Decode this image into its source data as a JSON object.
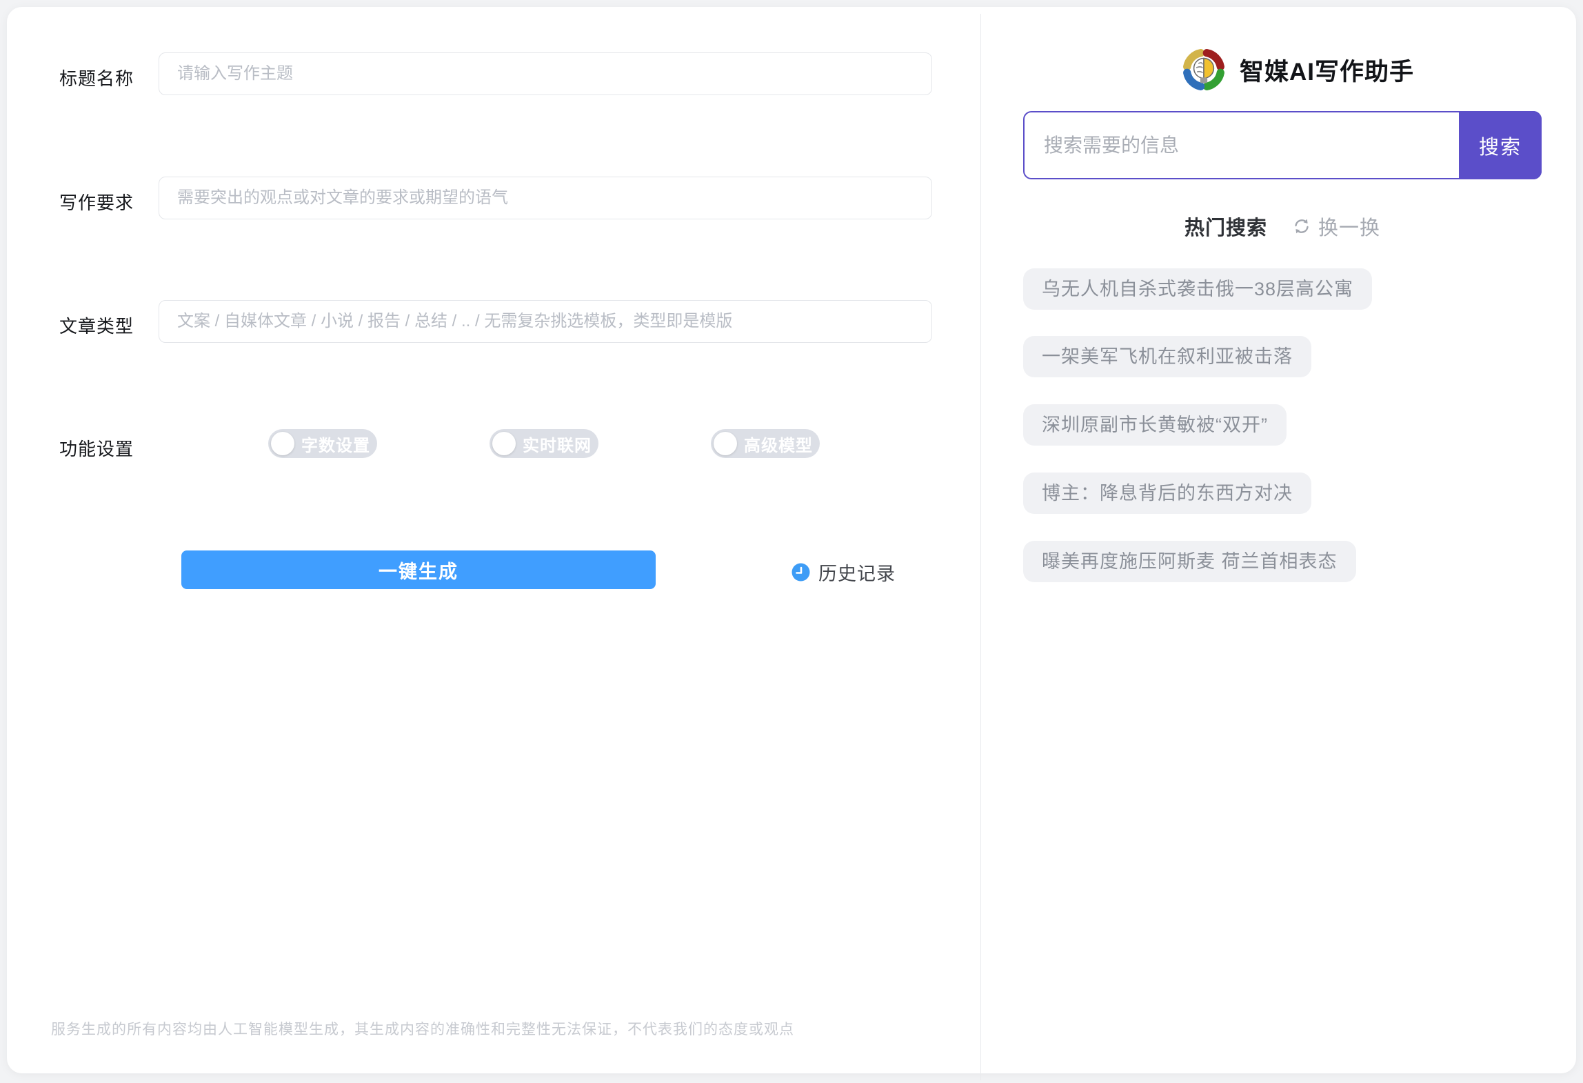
{
  "form": {
    "fields": [
      {
        "label": "标题名称",
        "placeholder": "请输入写作主题",
        "value": ""
      },
      {
        "label": "写作要求",
        "placeholder": "需要突出的观点或对文章的要求或期望的语气",
        "value": ""
      },
      {
        "label": "文章类型",
        "placeholder": "文案 / 自媒体文章 / 小说 / 报告 / 总结 / .. / 无需复杂挑选模板，类型即是模版",
        "value": ""
      }
    ],
    "settings": {
      "label": "功能设置",
      "toggles": [
        {
          "label": "字数设置",
          "state": "off"
        },
        {
          "label": "实时联网",
          "state": "off"
        },
        {
          "label": "高级模型",
          "state": "off"
        }
      ]
    },
    "generate_label": "一键生成",
    "history_label": "历史记录",
    "disclaimer": "服务生成的所有内容均由人工智能模型生成，其生成内容的准确性和完整性无法保证，不代表我们的态度或观点"
  },
  "panel": {
    "title": "智媒AI写作助手",
    "search": {
      "placeholder": "搜索需要的信息",
      "value": "",
      "button_label": "搜索"
    },
    "hot": {
      "title": "热门搜索",
      "refresh_label": "换一换",
      "items": [
        "乌无人机自杀式袭击俄一38层高公寓",
        "一架美军飞机在叙利亚被击落",
        "深圳原副市长黄敏被“双开”",
        "博主：降息背后的东西方对决",
        "曝美再度施压阿斯麦 荷兰首相表态"
      ]
    }
  },
  "colors": {
    "primary_blue": "#409eff",
    "accent_purple": "#5b4ec9",
    "clock_blue": "#3d9cf6",
    "toggle_gray": "#dcdfe6",
    "pill_gray": "#f0f1f4"
  }
}
